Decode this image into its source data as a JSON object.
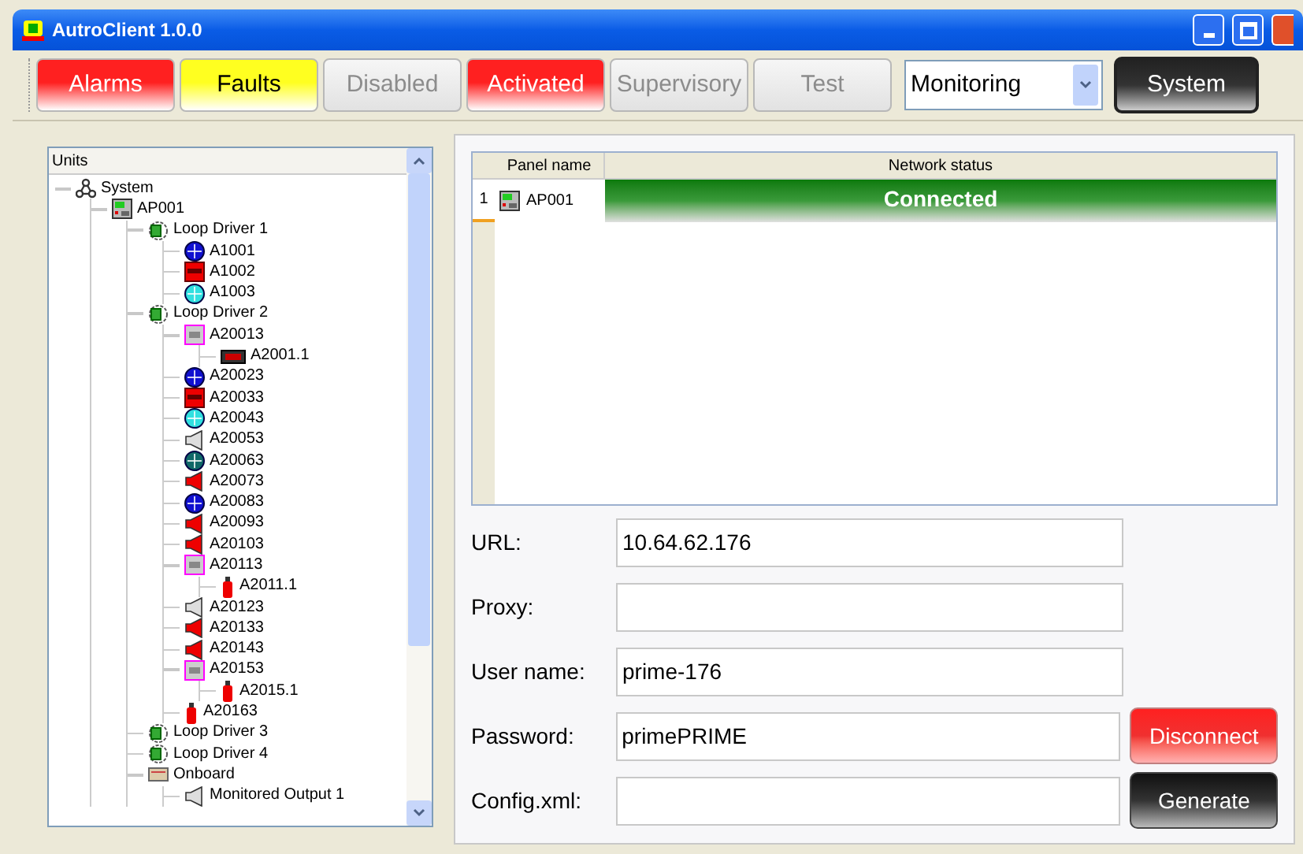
{
  "window": {
    "title": "AutroClient 1.0.0"
  },
  "toolbar": {
    "buttons": [
      {
        "label": "Alarms",
        "active": true,
        "color": "#ff2020"
      },
      {
        "label": "Faults",
        "active": true,
        "color": "#ffff20"
      },
      {
        "label": "Disabled",
        "active": false
      },
      {
        "label": "Activated",
        "active": true,
        "color": "#ff2020"
      },
      {
        "label": "Supervisory",
        "active": false
      },
      {
        "label": "Test",
        "active": false
      }
    ],
    "mode_select": {
      "value": "Monitoring"
    },
    "system_button": "System"
  },
  "units_tree": {
    "header": "Units",
    "items": [
      {
        "label": "System",
        "kind": "system",
        "children": [
          {
            "label": "AP001",
            "kind": "panel",
            "children": [
              {
                "label": "Loop Driver 1",
                "kind": "loop",
                "children": [
                  {
                    "label": "A1001",
                    "kind": "detector-blue"
                  },
                  {
                    "label": "A1002",
                    "kind": "red-panel"
                  },
                  {
                    "label": "A1003",
                    "kind": "detector-cyan"
                  }
                ]
              },
              {
                "label": "Loop Driver 2",
                "kind": "loop",
                "children": [
                  {
                    "label": "A20013",
                    "kind": "io-module",
                    "children": [
                      {
                        "label": "A2001.1",
                        "kind": "display"
                      }
                    ]
                  },
                  {
                    "label": "A20023",
                    "kind": "detector-blue"
                  },
                  {
                    "label": "A20033",
                    "kind": "red-panel"
                  },
                  {
                    "label": "A20043",
                    "kind": "detector-cyan"
                  },
                  {
                    "label": "A20053",
                    "kind": "sounder-grey"
                  },
                  {
                    "label": "A20063",
                    "kind": "detector-teal"
                  },
                  {
                    "label": "A20073",
                    "kind": "sounder-red"
                  },
                  {
                    "label": "A20083",
                    "kind": "detector-blue"
                  },
                  {
                    "label": "A20093",
                    "kind": "sounder-red"
                  },
                  {
                    "label": "A20103",
                    "kind": "sounder-red"
                  },
                  {
                    "label": "A20113",
                    "kind": "io-module",
                    "children": [
                      {
                        "label": "A2011.1",
                        "kind": "extinguisher"
                      }
                    ]
                  },
                  {
                    "label": "A20123",
                    "kind": "sounder-grey"
                  },
                  {
                    "label": "A20133",
                    "kind": "sounder-red"
                  },
                  {
                    "label": "A20143",
                    "kind": "sounder-red"
                  },
                  {
                    "label": "A20153",
                    "kind": "io-module",
                    "children": [
                      {
                        "label": "A2015.1",
                        "kind": "extinguisher"
                      }
                    ]
                  },
                  {
                    "label": "A20163",
                    "kind": "extinguisher"
                  }
                ]
              },
              {
                "label": "Loop Driver 3",
                "kind": "loop"
              },
              {
                "label": "Loop Driver 4",
                "kind": "loop"
              },
              {
                "label": "Onboard",
                "kind": "onboard",
                "children": [
                  {
                    "label": "Monitored Output 1",
                    "kind": "sounder-grey"
                  }
                ]
              }
            ]
          }
        ]
      }
    ]
  },
  "panels_table": {
    "columns": [
      "Panel name",
      "Network status"
    ],
    "rows": [
      {
        "index": "1",
        "panel_name": "AP001",
        "network_status": "Connected"
      }
    ]
  },
  "connection_form": {
    "fields": [
      {
        "label": "URL:",
        "value": "10.64.62.176"
      },
      {
        "label": "Proxy:"
      },
      {
        "label": "User name:",
        "value": "prime-176"
      },
      {
        "label": "Password:",
        "value": "primePRIME",
        "button": "Disconnect",
        "kind": "danger"
      },
      {
        "label": "Config.xml:",
        "button": "Generate",
        "kind": "dark"
      }
    ]
  }
}
